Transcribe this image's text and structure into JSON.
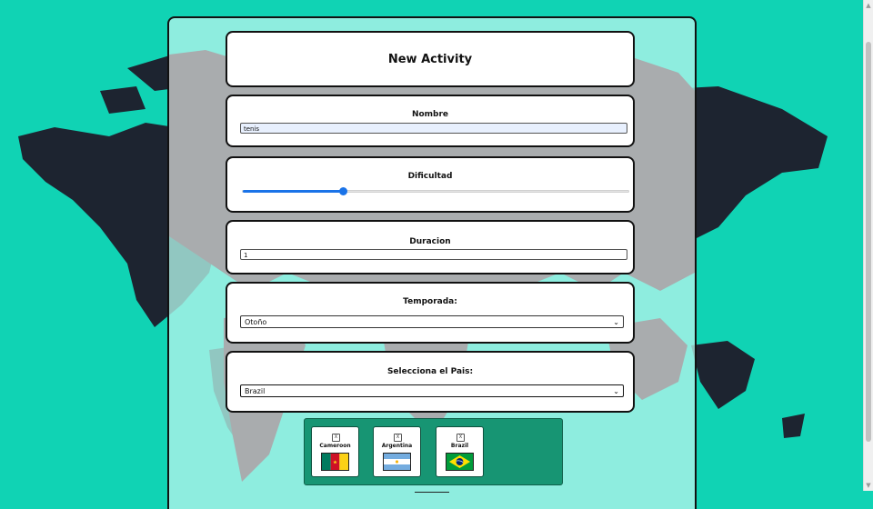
{
  "form": {
    "title": "New Activity",
    "name": {
      "label": "Nombre",
      "value": "tenis"
    },
    "difficulty": {
      "label": "Dificultad",
      "value_fraction": 0.26
    },
    "duration": {
      "label": "Duracion",
      "value": "1"
    },
    "season": {
      "label": "Temporada:",
      "selected": "Otoño"
    },
    "country": {
      "label": "Selecciona el Pais:",
      "selected": "Brazil"
    }
  },
  "selected_countries": [
    {
      "name": "Cameroon",
      "remove": "X",
      "flag": "cameroon-flag"
    },
    {
      "name": "Argentina",
      "remove": "X",
      "flag": "argentina-flag"
    },
    {
      "name": "Brazil",
      "remove": "X",
      "flag": "brazil-flag"
    }
  ],
  "colors": {
    "background": "#10d3b4",
    "land": "#1e2430",
    "countries_box": "#179573",
    "accent": "#1a73e8"
  }
}
